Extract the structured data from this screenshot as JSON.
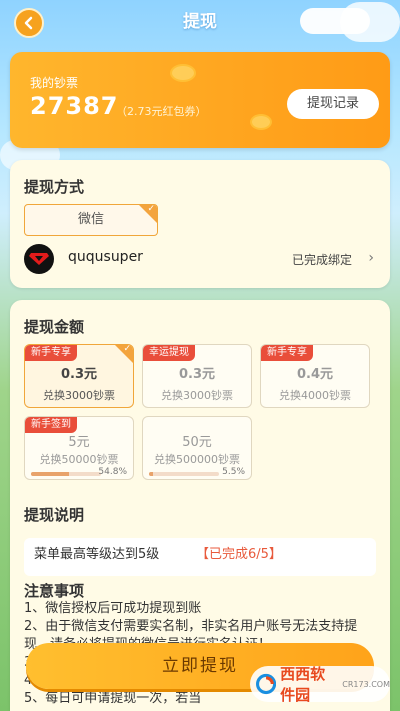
{
  "header": {
    "title": "提现"
  },
  "balance": {
    "label": "我的钞票",
    "value": "27387",
    "note": "（2.73元红包券）",
    "record_button": "提现记录"
  },
  "method": {
    "title": "提现方式",
    "option": "微信",
    "account_name": "ququsuper",
    "bind_status": "已完成绑定"
  },
  "amount": {
    "title": "提现金额",
    "options": [
      {
        "tag": "新手专享",
        "amount": "0.3元",
        "desc": "兑换3000钞票",
        "selected": true
      },
      {
        "tag": "幸运提现",
        "amount": "0.3元",
        "desc": "兑换3000钞票",
        "selected": false
      },
      {
        "tag": "新手专享",
        "amount": "0.4元",
        "desc": "兑换4000钞票",
        "selected": false
      },
      {
        "tag": "新手签到",
        "amount": "5元",
        "desc": "兑换50000钞票",
        "progress": 54.8,
        "progress_label": "54.8%"
      },
      {
        "tag": "",
        "amount": "50元",
        "desc": "兑换500000钞票",
        "progress": 5.5,
        "progress_label": "5.5%"
      }
    ]
  },
  "instructions": {
    "title": "提现说明",
    "requirement": "菜单最高等级达到5级",
    "status": "【已完成6/5】"
  },
  "notice": {
    "title": "注意事项",
    "lines": [
      "1、微信授权后可成功提现到账",
      "2、由于微信支付需要实名制，非实名用户账号无法支持提",
      "现，请务必将提现的微信号进行实名认证！",
      "3、",
      "4、",
      "5、每日可申请提现一次，若当"
    ]
  },
  "withdraw_button": "立即提现",
  "watermark": {
    "brand": "西西软件园",
    "domain": "CR173.COM"
  }
}
